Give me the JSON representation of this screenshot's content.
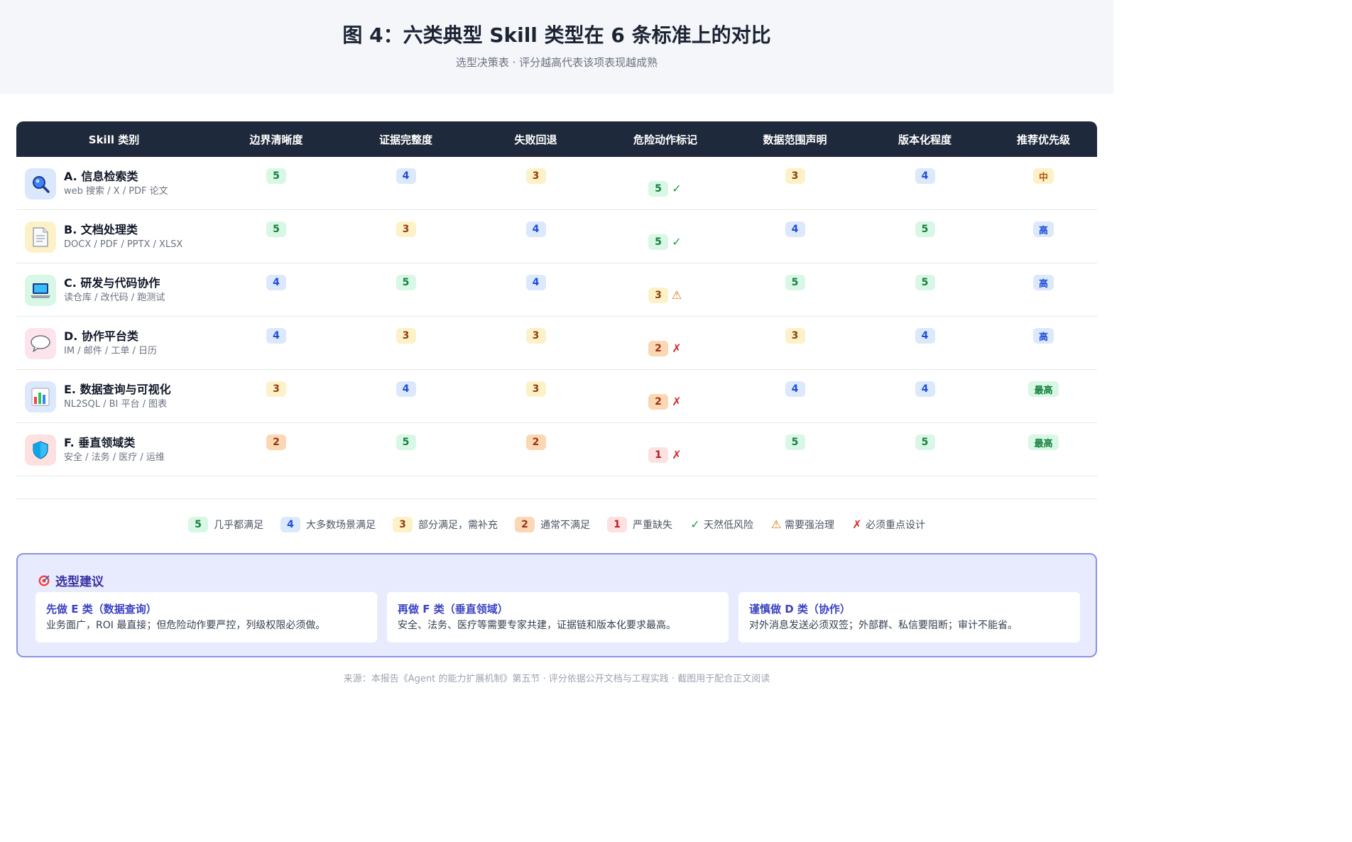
{
  "header": {
    "title": "图 4：六类典型 Skill 类型在 6 条标准上的对比",
    "subtitle": "选型决策表 · 评分越高代表该项表现越成熟"
  },
  "table": {
    "columns": [
      "Skill 类别",
      "边界清晰度",
      "证据完整度",
      "失败回退",
      "危险动作标记",
      "数据范围声明",
      "版本化程度",
      "推荐优先级"
    ],
    "rows": [
      {
        "name": "A. 信息检索类",
        "desc": "web 搜索 / X / PDF 论文",
        "icon": "magnifier-icon",
        "scores": [
          "5",
          "4",
          "3"
        ],
        "danger": "5",
        "danger_mark": "✓",
        "scores2": [
          "3",
          "4"
        ],
        "priority": "中"
      },
      {
        "name": "B. 文档处理类",
        "desc": "DOCX / PDF / PPTX / XLSX",
        "icon": "document-icon",
        "scores": [
          "5",
          "3",
          "4"
        ],
        "danger": "5",
        "danger_mark": "✓",
        "scores2": [
          "4",
          "5"
        ],
        "priority": "高"
      },
      {
        "name": "C. 研发与代码协作",
        "desc": "读仓库 / 改代码 / 跑测试",
        "icon": "laptop-icon",
        "scores": [
          "4",
          "5",
          "4"
        ],
        "danger": "3",
        "danger_mark": "⚠",
        "scores2": [
          "5",
          "5"
        ],
        "priority": "高"
      },
      {
        "name": "D. 协作平台类",
        "desc": "IM / 邮件 / 工单 / 日历",
        "icon": "chat-bubble-icon",
        "scores": [
          "4",
          "3",
          "3"
        ],
        "danger": "2",
        "danger_mark": "✗",
        "scores2": [
          "3",
          "4"
        ],
        "priority": "高"
      },
      {
        "name": "E. 数据查询与可视化",
        "desc": "NL2SQL / BI 平台 / 图表",
        "icon": "bar-chart-icon",
        "scores": [
          "3",
          "4",
          "3"
        ],
        "danger": "2",
        "danger_mark": "✗",
        "scores2": [
          "4",
          "4"
        ],
        "priority": "最高"
      },
      {
        "name": "F. 垂直领域类",
        "desc": "安全 / 法务 / 医疗 / 运维",
        "icon": "shield-icon",
        "scores": [
          "2",
          "5",
          "2"
        ],
        "danger": "1",
        "danger_mark": "✗",
        "scores2": [
          "5",
          "5"
        ],
        "priority": "最高"
      }
    ]
  },
  "legend": [
    {
      "badge": "5",
      "label": "几乎都满足"
    },
    {
      "badge": "4",
      "label": "大多数场景满足"
    },
    {
      "badge": "3",
      "label": "部分满足，需补充"
    },
    {
      "badge": "2",
      "label": "通常不满足"
    },
    {
      "badge": "1",
      "label": "严重缺失"
    },
    {
      "mark": "✓",
      "label": "天然低风险"
    },
    {
      "mark": "⚠",
      "label": "需要强治理"
    },
    {
      "mark": "✗",
      "label": "必须重点设计"
    }
  ],
  "advice": {
    "title": "选型建议",
    "icon": "target-icon",
    "cards": [
      {
        "title": "先做 E 类（数据查询）",
        "text": "业务面广，ROI 最直接；但危险动作要严控，列级权限必须做。"
      },
      {
        "title": "再做 F 类（垂直领域）",
        "text": "安全、法务、医疗等需要专家共建，证据链和版本化要求最高。"
      },
      {
        "title": "谨慎做 D 类（协作）",
        "text": "对外消息发送必须双签；外部群、私信要阻断；审计不能省。"
      }
    ]
  },
  "footer": {
    "source": "来源：本报告《Agent 的能力扩展机制》第五节 · 评分依据公开文档与工程实践 · 截图用于配合正文阅读"
  },
  "colors": {
    "header_bg": "#1e293b",
    "score5": "#d9f7e5",
    "score4": "#dce8fc",
    "score3": "#fdf1c8",
    "score2": "#fbd7b4",
    "score1": "#fde0e0",
    "advice_bg": "#e8ebfd",
    "advice_border": "#8b93e6"
  }
}
